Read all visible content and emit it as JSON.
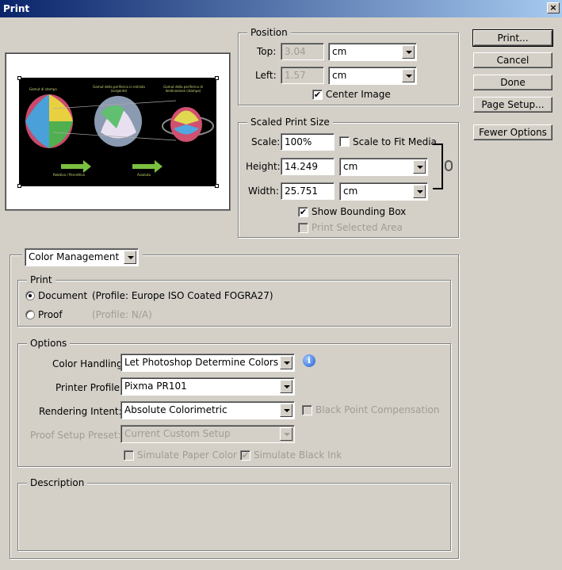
{
  "window": {
    "title": "Print",
    "close": "×"
  },
  "buttons": {
    "print": "Print...",
    "cancel": "Cancel",
    "done": "Done",
    "page_setup": "Page Setup...",
    "fewer_options": "Fewer Options"
  },
  "position": {
    "legend": "Position",
    "top_label": "Top:",
    "top_value": "3.04",
    "top_unit": "cm",
    "left_label": "Left:",
    "left_value": "1.57",
    "left_unit": "cm",
    "center_image": "Center Image",
    "center_checked": true
  },
  "scaled": {
    "legend": "Scaled Print Size",
    "scale_label": "Scale:",
    "scale_value": "100%",
    "fit_media": "Scale to Fit Media",
    "height_label": "Height:",
    "height_value": "14.249",
    "height_unit": "cm",
    "width_label": "Width:",
    "width_value": "25.751",
    "width_unit": "cm",
    "bounding_box": "Show Bounding Box",
    "print_selected": "Print Selected Area"
  },
  "preview": {
    "labels": {
      "left": "Gamut di stampa",
      "middle": "Gamut della periferica in entrata (sorgente)",
      "right": "Gamut della periferica di destinazione (stampa)",
      "arrow1": "Relativo / Percettivo",
      "arrow2": "Assoluto"
    }
  },
  "color_mgmt": {
    "dropdown": "Color Management",
    "print_legend": "Print",
    "document_label": "Document",
    "document_profile": "(Profile: Europe ISO Coated FOGRA27)",
    "proof_label": "Proof",
    "proof_profile": "(Profile: N/A)",
    "options_legend": "Options",
    "color_handling_label": "Color Handling:",
    "color_handling_value": "Let Photoshop Determine Colors",
    "printer_profile_label": "Printer Profile:",
    "printer_profile_value": "Pixma PR101",
    "rendering_label": "Rendering Intent:",
    "rendering_value": "Absolute Colorimetric",
    "black_point": "Black Point Compensation",
    "proof_setup_label": "Proof Setup Preset:",
    "proof_setup_value": "Current Custom Setup",
    "simulate_paper": "Simulate Paper Color",
    "simulate_ink": "Simulate Black Ink",
    "description_legend": "Description"
  }
}
